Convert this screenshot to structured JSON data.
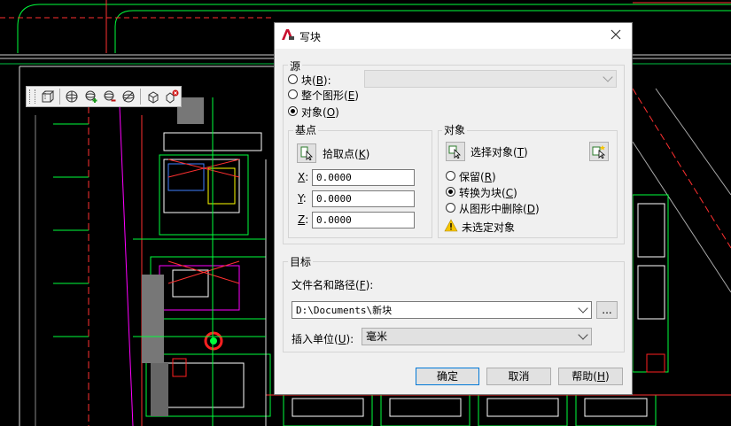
{
  "dialog": {
    "title": "写块",
    "source": {
      "legend": "源",
      "block_label": "块(B):",
      "entire_drawing_label": "整个图形(E)",
      "objects_label": "对象(O)",
      "block_value": ""
    },
    "base_point": {
      "legend": "基点",
      "pick_point_label": "拾取点(K)",
      "x_label": "X:",
      "y_label": "Y:",
      "z_label": "Z:",
      "x_value": "0.0000",
      "y_value": "0.0000",
      "z_value": "0.0000"
    },
    "objects": {
      "legend": "对象",
      "select_objects_label": "选择对象(T)",
      "retain_label": "保留(R)",
      "convert_label": "转换为块(C)",
      "delete_label": "从图形中删除(D)",
      "warning_text": "未选定对象"
    },
    "destination": {
      "legend": "目标",
      "filename_label": "文件名和路径(F):",
      "filename_value": "D:\\Documents\\新块",
      "browse_label": "...",
      "insert_units_label": "插入单位(U):",
      "insert_units_value": "毫米"
    },
    "buttons": {
      "ok": "确定",
      "cancel": "取消",
      "help": "帮助(H)"
    }
  },
  "colors": {
    "cad_background": "#000000",
    "cad_green": "#00ff3c",
    "cad_white": "#ffffff",
    "cad_red": "#ff2020",
    "cad_magenta": "#ff00ff",
    "warning_yellow": "#f5c400",
    "dialog_bg": "#f0f0f0"
  }
}
